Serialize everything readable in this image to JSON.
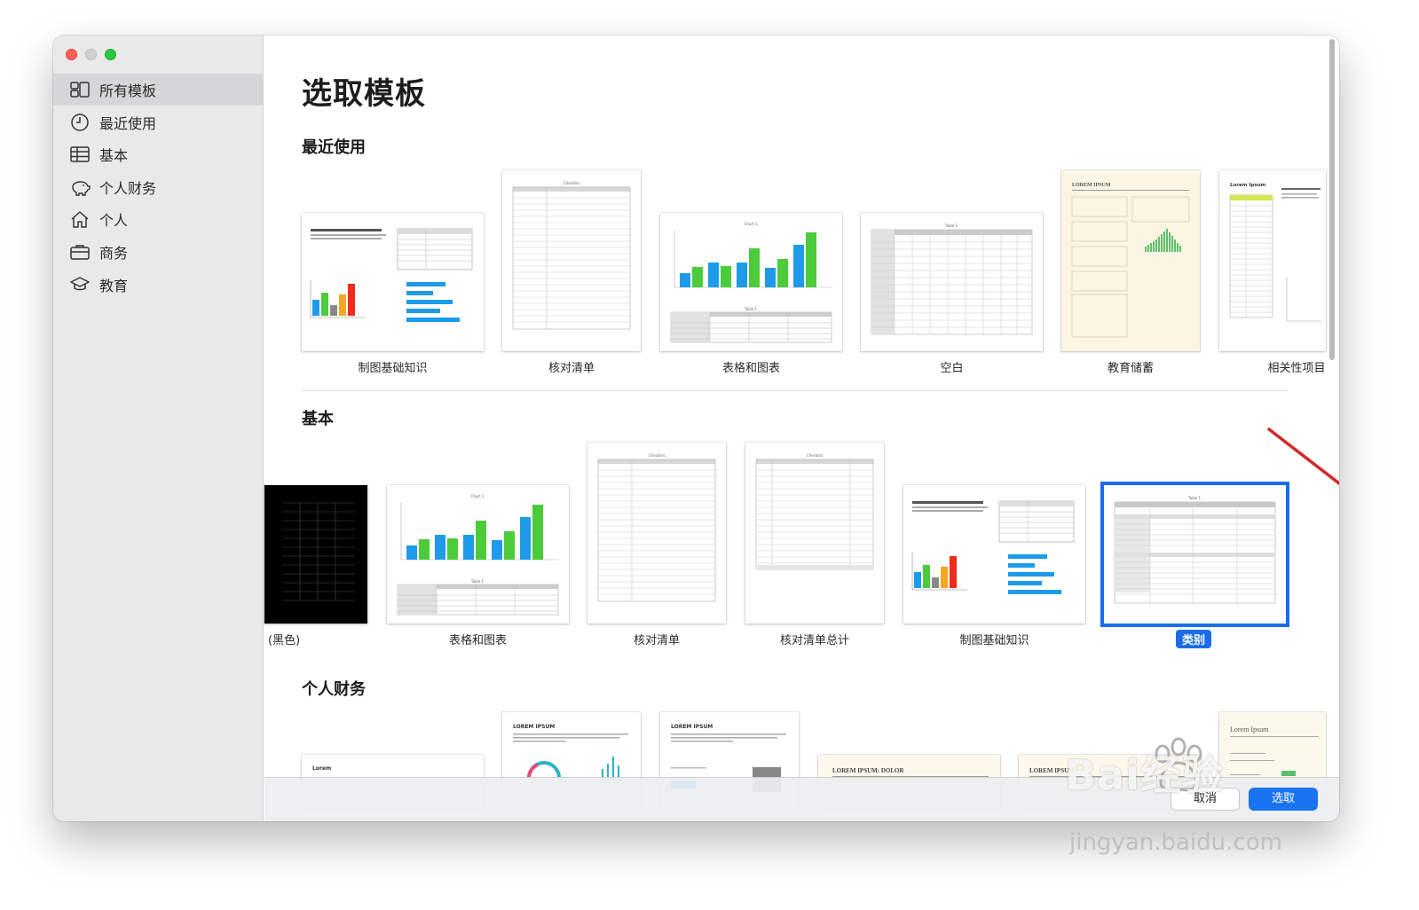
{
  "sidebar": {
    "items": [
      {
        "label": "所有模板",
        "icon": "grid-icon",
        "active": true
      },
      {
        "label": "最近使用",
        "icon": "clock-icon",
        "active": false
      },
      {
        "label": "基本",
        "icon": "table-icon",
        "active": false
      },
      {
        "label": "个人财务",
        "icon": "piggy-bank-icon",
        "active": false
      },
      {
        "label": "个人",
        "icon": "house-icon",
        "active": false
      },
      {
        "label": "商务",
        "icon": "briefcase-icon",
        "active": false
      },
      {
        "label": "教育",
        "icon": "graduation-cap-icon",
        "active": false
      }
    ]
  },
  "main": {
    "title": "选取模板",
    "sections": {
      "recent": {
        "title": "最近使用",
        "templates": [
          "制图基础知识",
          "核对清单",
          "表格和图表",
          "空白",
          "教育储蓄",
          "相关性项目"
        ]
      },
      "basic": {
        "title": "基本",
        "templates": [
          "(黑色)",
          "表格和图表",
          "核对清单",
          "核对清单总计",
          "制图基础知识",
          "类别"
        ],
        "selected": "类别"
      },
      "personal_finance": {
        "title": "个人财务",
        "preview_texts": [
          "Lorem",
          "LOREM IPSUM",
          "LOREM IPSUM",
          "LOREM IPSUM: DOLOR",
          "LOREM IPSUM",
          "Lorem Ipsum"
        ]
      }
    }
  },
  "thumb_texts": {
    "chart_title": "Chart 1",
    "table_title": "Table 1",
    "checklist_title": "Checklist",
    "lorem_ipsum_serif": "LOREM IPSUM",
    "lorem_ipsum": "Lorem Ipsum"
  },
  "footer": {
    "cancel": "取消",
    "choose": "选取"
  },
  "watermark": {
    "brand": "Bai经验",
    "url": "jingyan.baidu.com"
  },
  "colors": {
    "selection": "#1a6ce8",
    "annotation_arrow": "#d62828",
    "bar_blue": "#1e9be8",
    "bar_green": "#4ccc3a",
    "bar_orange": "#f5a623",
    "bar_red": "#f02b1e"
  }
}
